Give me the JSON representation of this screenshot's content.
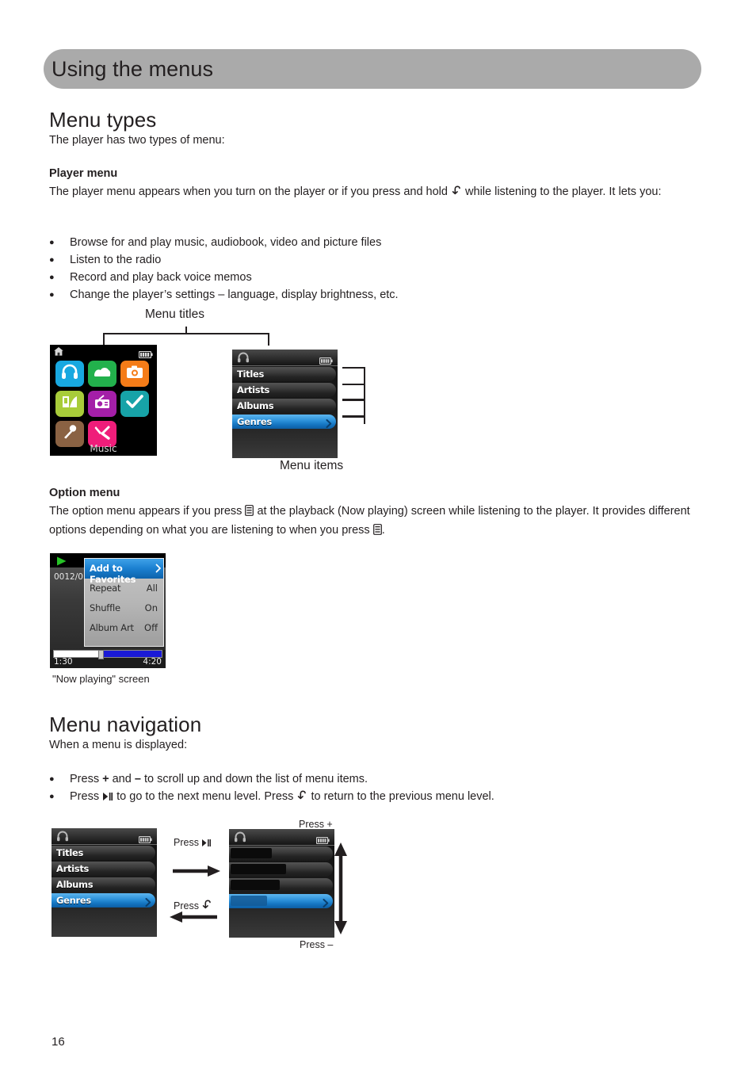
{
  "header": {
    "title": "Using the menus"
  },
  "sections": {
    "menu_types": {
      "heading": "Menu types",
      "intro": "The player has two types of menu:",
      "player_menu": {
        "heading": "Player menu",
        "para_part1": "The player menu appears when you turn on the player or if you press and hold",
        "para_part2": "while listening to the player. It lets you:",
        "bullets": [
          "Browse for and play music, audiobook, video and picture files",
          "Listen to the radio",
          "Record and play back voice memos",
          "Change the player’s settings – language, display brightness, etc."
        ]
      },
      "option_menu": {
        "heading": "Option menu",
        "para_part1": "The option menu appears if you press",
        "para_part2": "at the playback (Now playing) screen while listening to the player. It",
        "para_part3": "provides different options depending on what you are listening to when you press",
        "para_part4": "."
      }
    },
    "menu_navigation": {
      "heading": "Menu navigation",
      "intro": "When a menu is displayed:",
      "bullets": [
        {
          "pre": "Press",
          "plus": "+",
          "mid": "and",
          "minus": "–",
          "post": "to scroll up and down the list of menu items."
        },
        {
          "pre": "Press",
          "mid": "to go to the next menu level. Press",
          "post": "to return to the previous menu level."
        }
      ]
    }
  },
  "diagrams": {
    "menu_titles_label": "Menu titles",
    "menu_items_label": "Menu items",
    "now_playing_caption": "\"Now playing\" screen",
    "nav_labels": {
      "press_play": "Press",
      "press_back": "Press",
      "press_plus": "Press +",
      "press_minus": "Press –"
    }
  },
  "device": {
    "icon_grid": {
      "selected_label": "Music",
      "status_home_icon": "home-icon",
      "status_battery_icon": "battery-icon",
      "tiles": [
        {
          "name": "music",
          "icon": "headphones-icon",
          "color": "#18a8e0"
        },
        {
          "name": "video",
          "icon": "video-clip-icon",
          "color": "#22b14c"
        },
        {
          "name": "pictures",
          "icon": "camera-icon",
          "color": "#f57c18"
        },
        {
          "name": "audiobooks",
          "icon": "book-icon",
          "color": "#a8cc3a"
        },
        {
          "name": "radio",
          "icon": "radio-icon",
          "color": "#a41fa8"
        },
        {
          "name": "tasks",
          "icon": "check-icon",
          "color": "#17a3a8"
        },
        {
          "name": "voice-memo",
          "icon": "microphone-icon",
          "color": "#8a6243"
        },
        {
          "name": "settings",
          "icon": "tools-icon",
          "color": "#ef1d7a"
        }
      ]
    },
    "list_menu": {
      "status_headphone_icon": "headphone-icon",
      "status_battery_icon": "battery-icon",
      "items": [
        {
          "label": "Titles",
          "selected": false
        },
        {
          "label": "Artists",
          "selected": false
        },
        {
          "label": "Albums",
          "selected": false
        },
        {
          "label": "Genres",
          "selected": true
        }
      ]
    },
    "now_playing": {
      "play_icon": "play-icon",
      "track_counter": "0012/0",
      "time_elapsed": "1:30",
      "time_total": "4:20",
      "option_panel": [
        {
          "label": "Add to Favorites",
          "value": "",
          "selected": true
        },
        {
          "label": "Repeat",
          "value": "All",
          "selected": false
        },
        {
          "label": "Shuffle",
          "value": "On",
          "selected": false
        },
        {
          "label": "Album Art",
          "value": "Off",
          "selected": false
        }
      ]
    },
    "nav_list_redacted": {
      "status_headphone_icon": "headphone-icon",
      "status_battery_icon": "battery-icon",
      "rows": [
        {
          "label": "",
          "selected": false,
          "redact_width": 52
        },
        {
          "label": "",
          "selected": false,
          "redact_width": 70
        },
        {
          "label": "",
          "selected": false,
          "redact_width": 62
        },
        {
          "label": "",
          "selected": true,
          "redact_width": 46
        }
      ]
    }
  },
  "footer": {
    "page_number": "16"
  },
  "colors": {
    "header_bar": "#aaaaaa",
    "text": "#231f20",
    "selection_blue": "#1a7fd0",
    "progress_blue": "#1a1ad6"
  }
}
